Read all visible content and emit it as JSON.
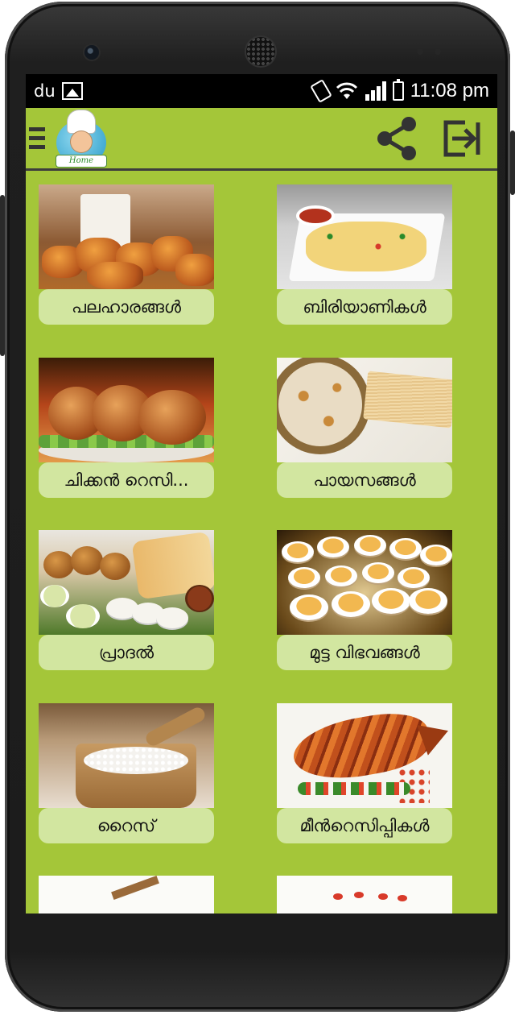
{
  "status_bar": {
    "carrier": "du",
    "time": "11:08 pm"
  },
  "toolbar": {
    "logo_text": "Home"
  },
  "categories": [
    {
      "label": "പലഹാരങ്ങൾ",
      "image": "snacks-with-tea"
    },
    {
      "label": "ബിരിയാണികൾ",
      "image": "biryani-plate"
    },
    {
      "label": "ചിക്കൻ റെസി...",
      "image": "roast-chicken"
    },
    {
      "label": "പായസങ്ങൾ",
      "image": "payasam-bowl"
    },
    {
      "label": "പ്രാദൽ",
      "image": "south-indian-breakfast"
    },
    {
      "label": "മുട്ട വിഭവങ്ങൾ",
      "image": "deviled-eggs"
    },
    {
      "label": "റൈസ്",
      "image": "rice-pot"
    },
    {
      "label": "മീൻറെസിപ്പികൾ",
      "image": "fried-fish"
    }
  ],
  "colors": {
    "screen_bg": "#a4c639",
    "label_bg": "#d2e6a0",
    "icon": "#333333"
  }
}
